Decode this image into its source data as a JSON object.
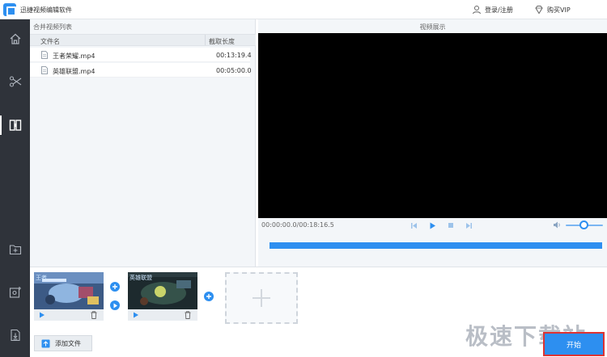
{
  "app": {
    "title": "迅捷视频编辑软件"
  },
  "header": {
    "login_label": "登录/注册",
    "vip_label": "购买VIP"
  },
  "sidebar": {
    "items": [
      {
        "icon": "home-icon"
      },
      {
        "icon": "scissors-icon"
      },
      {
        "icon": "merge-icon"
      },
      {
        "icon": "add-folder-icon"
      },
      {
        "icon": "add-settings-icon"
      },
      {
        "icon": "download-icon"
      }
    ]
  },
  "file_list": {
    "title": "合并视频列表",
    "columns": [
      "文件名",
      "截取长度"
    ],
    "rows": [
      {
        "name": "王者荣耀.mp4",
        "duration": "00:13:19.4"
      },
      {
        "name": "英雄联盟.mp4",
        "duration": "00:05:00.0"
      }
    ]
  },
  "preview": {
    "title": "视频展示",
    "timecode": "00:00:00.0/00:18:16.5",
    "volume_level": 0.5,
    "progress": 1.0
  },
  "clips": [
    {
      "label": "王者"
    },
    {
      "label": "英雄联盟"
    }
  ],
  "bottom": {
    "add_file_label": "添加文件",
    "start_label": "开始",
    "watermark": "极速下载站"
  },
  "colors": {
    "accent": "#2d8ff0",
    "sidebar": "#2f333a",
    "highlight_border": "#dd3333"
  }
}
